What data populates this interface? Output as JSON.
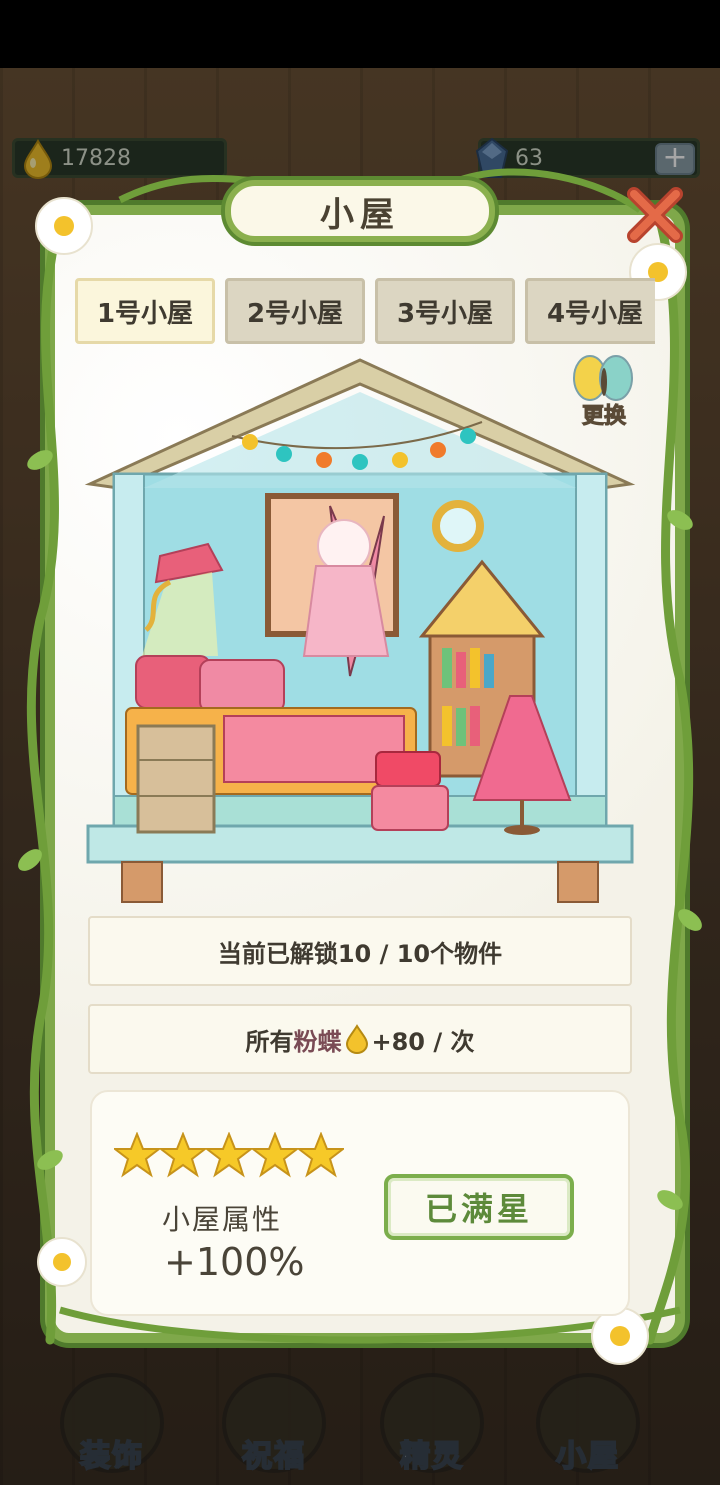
{
  "currency": {
    "drops": "17828",
    "gems": "63"
  },
  "panel": {
    "title": "小屋",
    "tabs": [
      "1号小屋",
      "2号小屋",
      "3号小屋",
      "4号小屋"
    ],
    "active_tab": 0,
    "swap_label": "更换",
    "unlock_text": "当前已解锁10 / 10个物件",
    "bonus_prefix": "所有",
    "bonus_highlight": "粉蝶",
    "bonus_suffix": "+80 / 次",
    "stars": 5,
    "attr_label": "小屋属性",
    "attr_value": "+100%",
    "max_button": "已满星"
  },
  "bottom_nav": [
    "装饰",
    "祝福",
    "精灵",
    "小屋"
  ],
  "colors": {
    "vine": "#7fa84a",
    "star": "#f6c928",
    "accent_green": "#5d8a3a"
  }
}
